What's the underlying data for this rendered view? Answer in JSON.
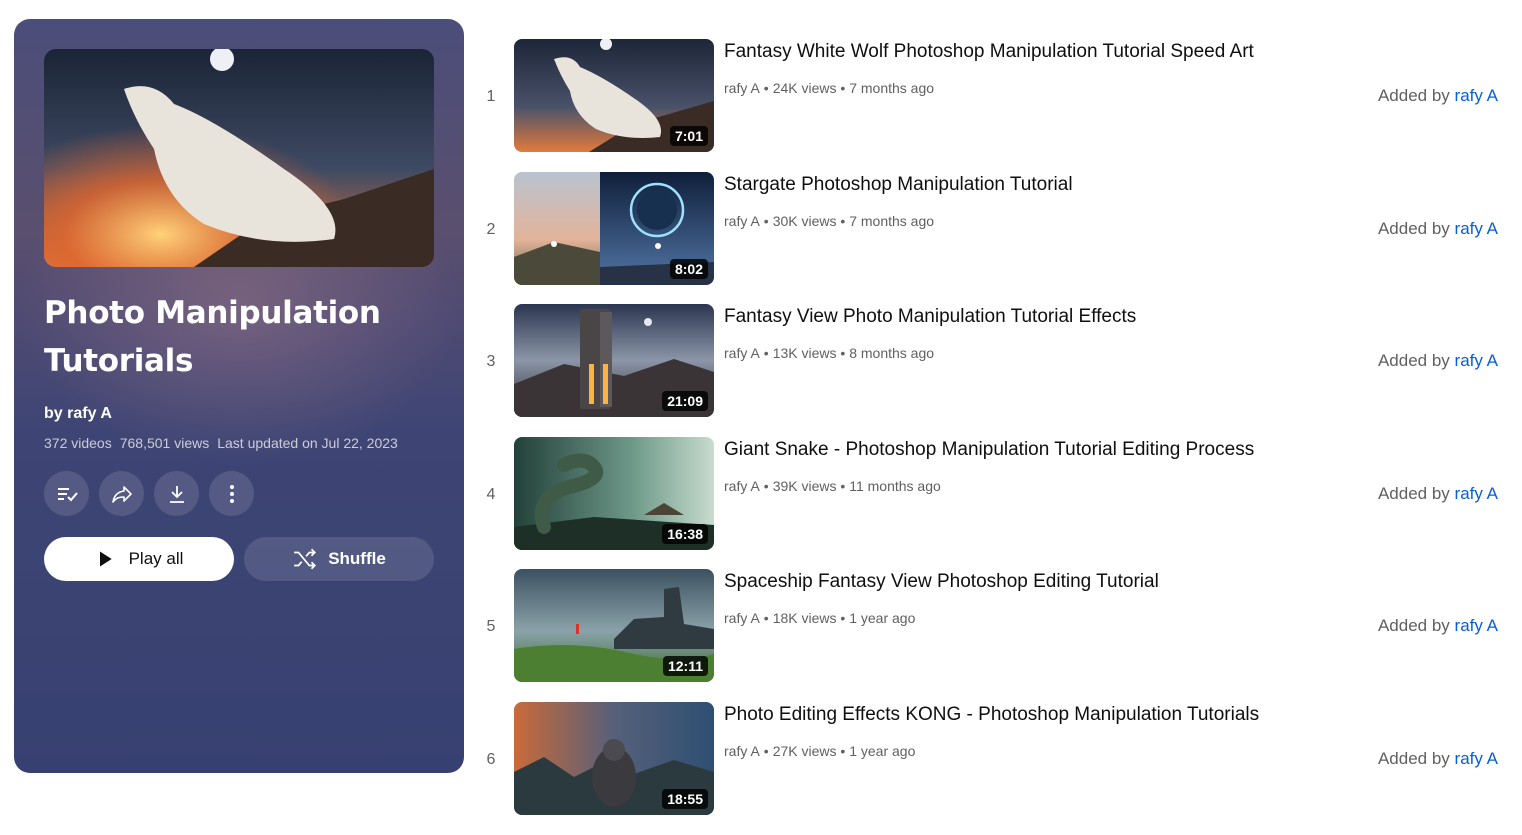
{
  "playlist": {
    "title": "Photo Manipulation Tutorials",
    "owner": "by rafy A",
    "video_count": "372 videos",
    "views": "768,501 views",
    "updated": "Last updated on Jul 22, 2023",
    "play_all_label": "Play all",
    "shuffle_label": "Shuffle",
    "action_icons": [
      "save-to-library-icon",
      "share-icon",
      "download-icon",
      "more-options-icon"
    ]
  },
  "videos": [
    {
      "index": "1",
      "title": "Fantasy White Wolf Photoshop Manipulation Tutorial Speed Art",
      "channel": "rafy A",
      "views": "24K views",
      "age": "7 months ago",
      "duration": "7:01",
      "added_prefix": "Added by",
      "added_by": "rafy A"
    },
    {
      "index": "2",
      "title": "Stargate Photoshop Manipulation Tutorial",
      "channel": "rafy A",
      "views": "30K views",
      "age": "7 months ago",
      "duration": "8:02",
      "added_prefix": "Added by",
      "added_by": "rafy A"
    },
    {
      "index": "3",
      "title": "Fantasy View Photo Manipulation Tutorial Effects",
      "channel": "rafy A",
      "views": "13K views",
      "age": "8 months ago",
      "duration": "21:09",
      "added_prefix": "Added by",
      "added_by": "rafy A"
    },
    {
      "index": "4",
      "title": "Giant Snake - Photoshop Manipulation Tutorial Editing Process",
      "channel": "rafy A",
      "views": "39K views",
      "age": "11 months ago",
      "duration": "16:38",
      "added_prefix": "Added by",
      "added_by": "rafy A"
    },
    {
      "index": "5",
      "title": "Spaceship Fantasy View Photoshop Editing Tutorial",
      "channel": "rafy A",
      "views": "18K views",
      "age": "1 year ago",
      "duration": "12:11",
      "added_prefix": "Added by",
      "added_by": "rafy A"
    },
    {
      "index": "6",
      "title": "Photo Editing Effects KONG - Photoshop Manipulation Tutorials",
      "channel": "rafy A",
      "views": "27K views",
      "age": "1 year ago",
      "duration": "18:55",
      "added_prefix": "Added by",
      "added_by": "rafy A"
    }
  ],
  "colors": {
    "link": "#065fd4",
    "panel": "#3e4574",
    "meta_text": "#606060"
  }
}
